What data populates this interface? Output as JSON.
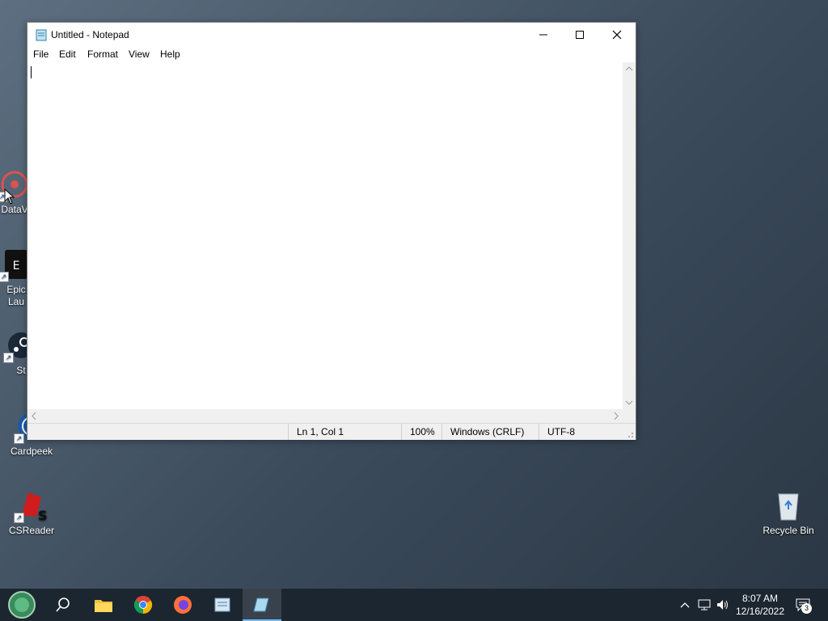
{
  "desktop": {
    "icons": [
      {
        "label": "DataV"
      },
      {
        "label": "Epic\nLau"
      },
      {
        "label": "St"
      },
      {
        "label": "Cardpeek"
      },
      {
        "label": "CSReader"
      },
      {
        "label": "Recycle Bin"
      }
    ]
  },
  "notepad": {
    "title": "Untitled - Notepad",
    "menu": [
      "File",
      "Edit",
      "Format",
      "View",
      "Help"
    ],
    "content": "",
    "status": {
      "position": "Ln 1, Col 1",
      "zoom": "100%",
      "line_ending": "Windows (CRLF)",
      "encoding": "UTF-8"
    }
  },
  "taskbar": {
    "apps": [
      "start-icon",
      "search-icon",
      "file-explorer-icon",
      "chrome-icon",
      "firefox-icon",
      "app-icon",
      "notepad-icon"
    ],
    "clock": {
      "time": "8:07 AM",
      "date": "12/16/2022"
    },
    "notifications": "3"
  },
  "colors": {
    "taskbar": "#1c2630",
    "accent": "#76b9ed",
    "status_bar": "#f0f0f0"
  }
}
